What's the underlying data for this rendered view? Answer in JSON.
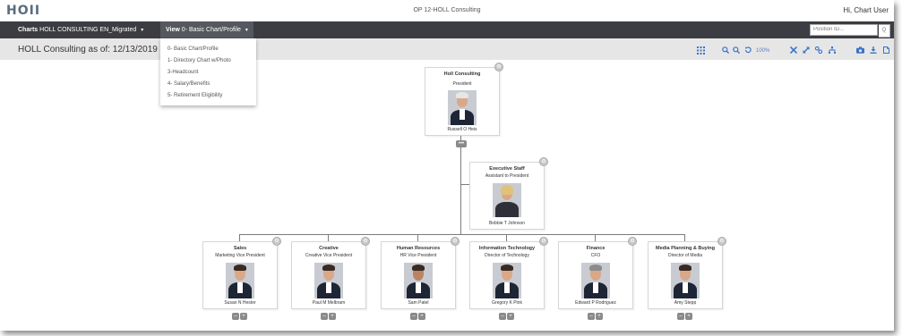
{
  "app": {
    "logo": "HOII",
    "title": "OP 12-HOLL Consulting",
    "greeting": "Hi, Chart User"
  },
  "nav": {
    "charts_label": "Charts",
    "charts_value": "HOLL CONSULTING EN_Migrated",
    "view_label": "View",
    "view_value": "0- Basic Chart/Profile",
    "position_placeholder": "Position ID...",
    "search_glyph": "Q"
  },
  "toolbar": {
    "as_of": "HOLL Consulting as of: 12/13/2019",
    "zoom": "100%",
    "icons": [
      "grid-icon",
      "zoom-in-icon",
      "zoom-out-icon",
      "reset-zoom-icon",
      "collapse-icon",
      "expand-icon",
      "link-icon",
      "hierarchy-icon",
      "camera-icon",
      "download-icon",
      "pdf-icon"
    ]
  },
  "view_menu": {
    "items": [
      "0- Basic Chart/Profile",
      "1- Directory Chart w/Photo",
      "3-Headcount",
      "4- Salary/Benefits",
      "5- Retirement Eligibility"
    ]
  },
  "org": {
    "root": {
      "title": "Holl Consulting",
      "position": "President",
      "name": "Russell O Heis"
    },
    "assistant": {
      "title": "Executive Staff",
      "position": "Assistant to President",
      "name": "Bobbie T Johnson"
    },
    "departments": [
      {
        "title": "Sales",
        "position": "Marketing Vice President",
        "name": "Susan N Hester"
      },
      {
        "title": "Creative",
        "position": "Creative Vice President",
        "name": "Paul M Melbram"
      },
      {
        "title": "Human Resources",
        "position": "HR Vice President",
        "name": "Sam Patel"
      },
      {
        "title": "Information Technology",
        "position": "Director of Technology",
        "name": "Gregory K Pink"
      },
      {
        "title": "Finance",
        "position": "CFO",
        "name": "Edward P Rodriguez"
      },
      {
        "title": "Media Planning & Buying",
        "position": "Director of Media",
        "name": "Amy Stepp"
      }
    ]
  }
}
